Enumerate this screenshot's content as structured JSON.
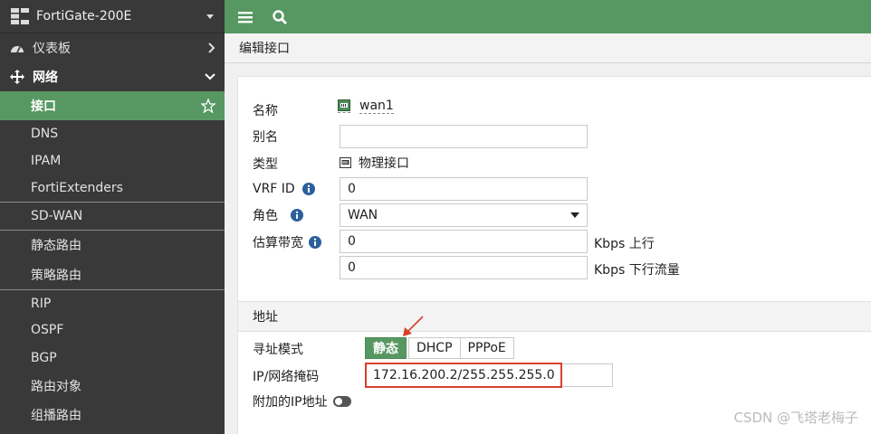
{
  "sidebar": {
    "device_name": "FortiGate-200E",
    "top_items": [
      {
        "label": "仪表板"
      },
      {
        "label": "网络"
      }
    ],
    "sub_items": [
      {
        "label": "接口"
      },
      {
        "label": "DNS"
      },
      {
        "label": "IPAM"
      },
      {
        "label": "FortiExtenders"
      },
      {
        "label": "SD-WAN"
      },
      {
        "label": "静态路由"
      },
      {
        "label": "策略路由"
      },
      {
        "label": "RIP"
      },
      {
        "label": "OSPF"
      },
      {
        "label": "BGP"
      },
      {
        "label": "路由对象"
      },
      {
        "label": "组播路由"
      }
    ]
  },
  "page": {
    "title": "编辑接口"
  },
  "form": {
    "name_label": "名称",
    "name_value": "wan1",
    "alias_label": "别名",
    "alias_value": "",
    "type_label": "类型",
    "type_value": "物理接口",
    "vrf_label": "VRF ID",
    "vrf_value": "0",
    "role_label": "角色",
    "role_value": "WAN",
    "bandwidth_label": "估算带宽",
    "bw_up_value": "0",
    "bw_up_unit": "Kbps 上行",
    "bw_down_value": "0",
    "bw_down_unit": "Kbps 下行流量"
  },
  "address": {
    "section_title": "地址",
    "mode_label": "寻址模式",
    "modes": [
      "静态",
      "DHCP",
      "PPPoE"
    ],
    "ip_label": "IP/网络掩码",
    "ip_value": "172.16.200.2/255.255.255.0",
    "extra_ip_label": "附加的IP地址"
  },
  "watermark": "CSDN @飞塔老梅子",
  "colors": {
    "accent": "#579862",
    "sidebar_bg": "#393939",
    "highlight_red": "#d9402b"
  }
}
